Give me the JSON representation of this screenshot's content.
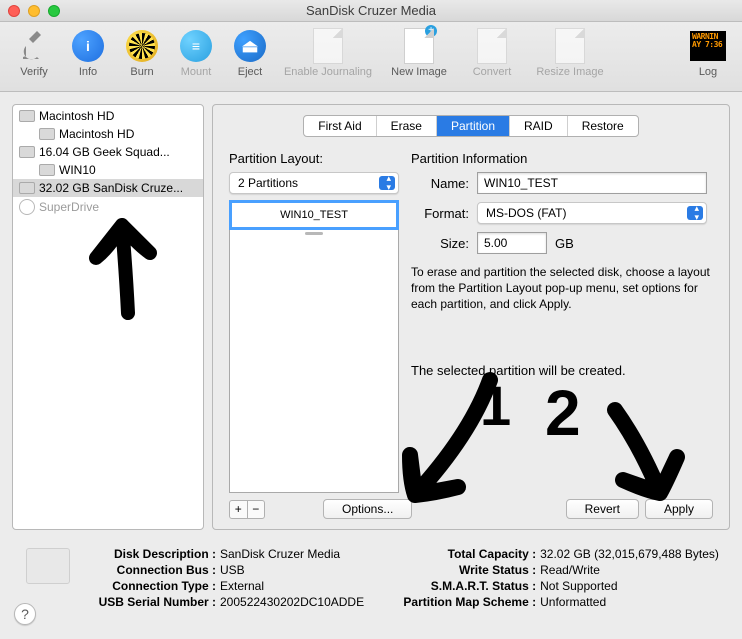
{
  "window": {
    "title": "SanDisk Cruzer Media"
  },
  "toolbar": {
    "verify": "Verify",
    "info": "Info",
    "burn": "Burn",
    "mount": "Mount",
    "eject": "Eject",
    "enable_journaling": "Enable Journaling",
    "new_image": "New Image",
    "convert": "Convert",
    "resize_image": "Resize Image",
    "log": "Log",
    "log_text": "WARNIN\nAY 7:36"
  },
  "sidebar": {
    "items": [
      {
        "label": "Macintosh HD"
      },
      {
        "label": "Macintosh HD"
      },
      {
        "label": "16.04 GB Geek Squad..."
      },
      {
        "label": "WIN10"
      },
      {
        "label": "32.02 GB SanDisk Cruze..."
      },
      {
        "label": "SuperDrive"
      }
    ]
  },
  "tabs": {
    "first_aid": "First Aid",
    "erase": "Erase",
    "partition": "Partition",
    "raid": "RAID",
    "restore": "Restore"
  },
  "layout": {
    "heading": "Partition Layout:",
    "dropdown": "2 Partitions",
    "partitions": [
      "WIN10_TEST"
    ]
  },
  "info": {
    "heading": "Partition Information",
    "name_label": "Name:",
    "name_value": "WIN10_TEST",
    "format_label": "Format:",
    "format_value": "MS-DOS (FAT)",
    "size_label": "Size:",
    "size_value": "5.00",
    "size_unit": "GB",
    "help": "To erase and partition the selected disk, choose a layout from the Partition Layout pop-up menu, set options for each partition, and click Apply.",
    "status": "The selected partition will be created."
  },
  "buttons": {
    "options": "Options...",
    "revert": "Revert",
    "apply": "Apply"
  },
  "footer": {
    "left": {
      "disk_description_k": "Disk Description :",
      "disk_description_v": "SanDisk Cruzer Media",
      "connection_bus_k": "Connection Bus :",
      "connection_bus_v": "USB",
      "connection_type_k": "Connection Type :",
      "connection_type_v": "External",
      "usb_serial_k": "USB Serial Number :",
      "usb_serial_v": "200522430202DC10ADDE"
    },
    "right": {
      "total_capacity_k": "Total Capacity :",
      "total_capacity_v": "32.02 GB (32,015,679,488 Bytes)",
      "write_status_k": "Write Status :",
      "write_status_v": "Read/Write",
      "smart_k": "S.M.A.R.T. Status :",
      "smart_v": "Not Supported",
      "pms_k": "Partition Map Scheme :",
      "pms_v": "Unformatted"
    }
  },
  "annotations": {
    "one": "1",
    "two": "2"
  }
}
